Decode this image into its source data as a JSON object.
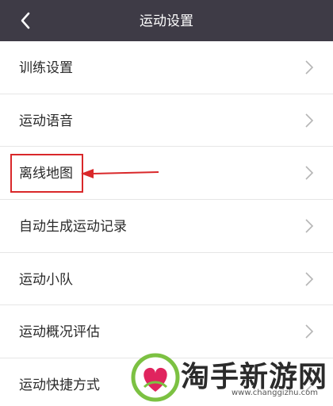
{
  "header": {
    "title": "运动设置",
    "back_icon": "chevron-left-icon",
    "background_color": "#3e3b46"
  },
  "settings": {
    "items": [
      {
        "label": "训练设置"
      },
      {
        "label": "运动语音"
      },
      {
        "label": "离线地图"
      },
      {
        "label": "自动生成运动记录"
      },
      {
        "label": "运动小队"
      },
      {
        "label": "运动概况评估"
      },
      {
        "label": "运动快捷方式"
      }
    ],
    "chevron_icon": "chevron-right-icon"
  },
  "annotation": {
    "highlighted_item": "离线地图",
    "color": "#d9282a"
  },
  "watermark": {
    "title": "淘手新游网",
    "url": "www.changgizhu.com"
  }
}
